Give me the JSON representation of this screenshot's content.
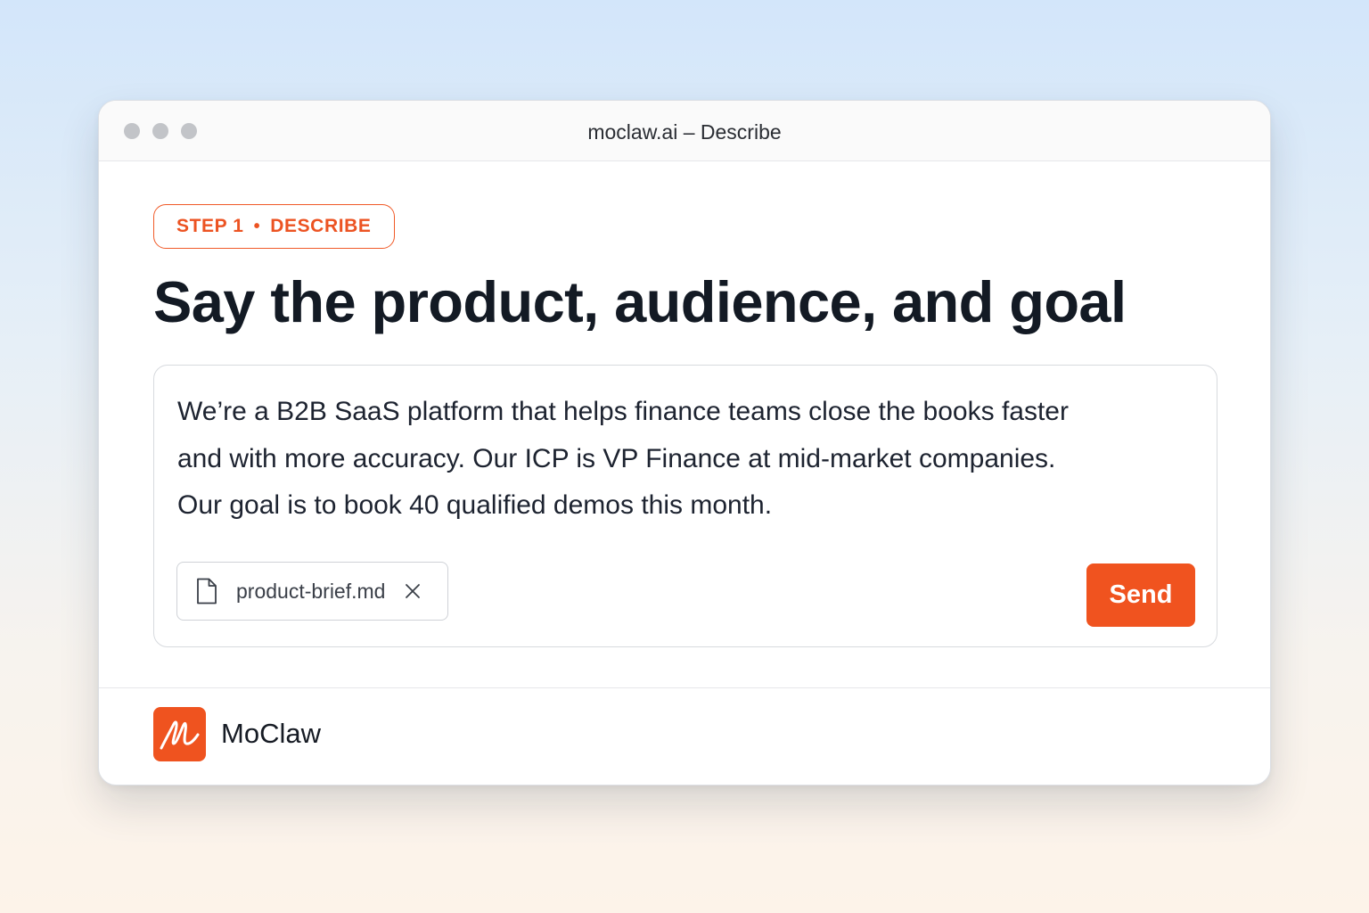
{
  "window": {
    "title": "moclaw.ai – Describe"
  },
  "step": {
    "number_label": "STEP 1",
    "separator": "•",
    "name": "DESCRIBE"
  },
  "headline": "Say the product, audience, and goal",
  "composer": {
    "text": "We’re a B2B SaaS platform that helps finance teams close the books faster and with more accuracy. Our ICP is VP Finance at mid-market companies. Our goal is to book 40 qualified demos this month.",
    "attachment": {
      "file_name": "product-brief.md",
      "icon": "document-icon"
    },
    "send_label": "Send"
  },
  "footer": {
    "brand_name": "MoClaw",
    "logo_icon": "moclaw-logo-icon"
  },
  "colors": {
    "accent": "#f0531f",
    "heading": "#131a24",
    "text": "#1d2330"
  }
}
